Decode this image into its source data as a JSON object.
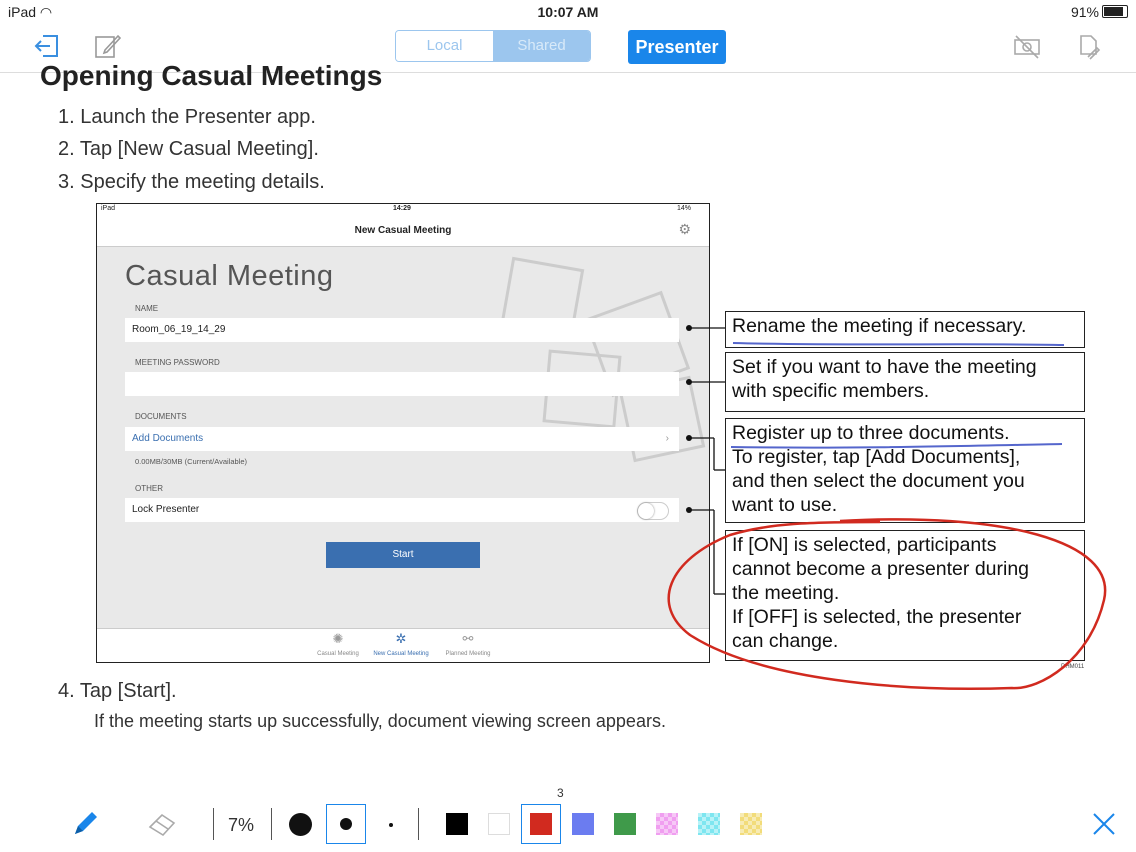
{
  "status": {
    "device": "iPad",
    "time": "10:07 AM",
    "battery": "91%"
  },
  "toolbar": {
    "exit_icon": "exit-icon",
    "edit_icon": "edit-icon",
    "seg_local": "Local",
    "seg_shared": "Shared",
    "presenter_label": "Presenter",
    "camera_off_icon": "camera-off-icon",
    "doc_icon": "document-icon"
  },
  "doc": {
    "title": "Opening Casual Meetings",
    "steps": [
      "1.  Launch the Presenter app.",
      "2.  Tap [New Casual Meeting].",
      "3.  Specify the meeting details.",
      "4.  Tap [Start]."
    ],
    "step4_sub": "If the meeting starts up successfully, document viewing screen appears.",
    "embed": {
      "sb_left": "iPad",
      "sb_time": "14:29",
      "sb_batt": "14%",
      "nav_title": "New Casual Meeting",
      "heading": "Casual Meeting",
      "name_label": "NAME",
      "name_value": "Room_06_19_14_29",
      "pwd_label": "MEETING PASSWORD",
      "docs_label": "DOCUMENTS",
      "add_docs": "Add Documents",
      "storage": "0.00MB/30MB (Current/Available)",
      "other_label": "OTHER",
      "lock_label": "Lock Presenter",
      "start_label": "Start",
      "tab1": "Casual Meeting",
      "tab2": "New Casual Meeting",
      "tab3": "Planned Meeting"
    },
    "callouts": {
      "c1": "Rename the meeting if necessary.",
      "c2a": "Set if you want to have the meeting",
      "c2b": "with specific members.",
      "c3a": "Register up to three documents.",
      "c3b": "To register, tap [Add Documents],",
      "c3c": "and then select the document you",
      "c3d": "want to use.",
      "c4a": "If [ON] is selected, participants",
      "c4b": "cannot become a presenter during",
      "c4c": "the meeting.",
      "c4d": "If [OFF] is selected, the presenter",
      "c4e": "can change."
    },
    "figure_code": "DHM011"
  },
  "annotation_bar": {
    "zoom": "7%",
    "small_marker": "3",
    "colors": [
      "#000000",
      "#ffffff",
      "#d12a1f",
      "#6b7cf0",
      "#3f9a4a",
      "#f09ef0",
      "#7ee6f0",
      "#f2dc7a"
    ]
  }
}
